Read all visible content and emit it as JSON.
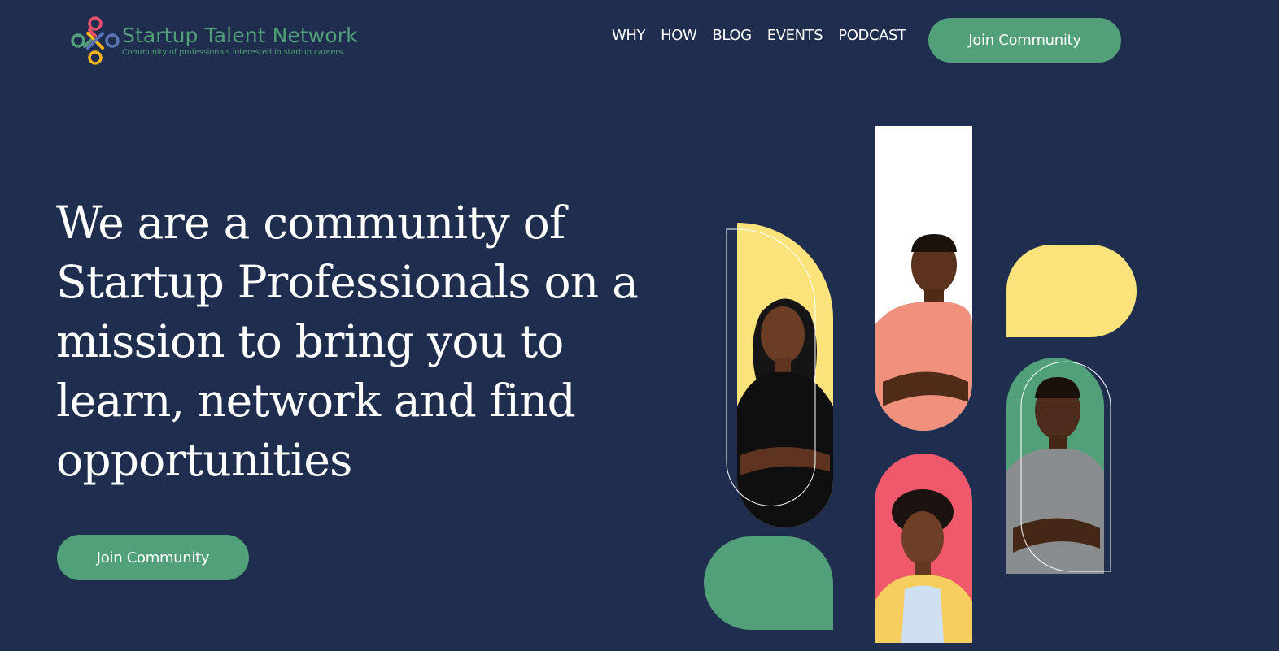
{
  "brand": {
    "name": "Startup Talent Network",
    "tagline": "Community of professionals interested in startup careers",
    "colors": {
      "background": "#1f2d4f",
      "primary_green": "#52a079",
      "yellow": "#fbe27a",
      "coral": "#f0586c",
      "white": "#ffffff"
    }
  },
  "nav": {
    "items": [
      {
        "label": "WHY"
      },
      {
        "label": "HOW"
      },
      {
        "label": "BLOG"
      },
      {
        "label": "EVENTS"
      },
      {
        "label": "PODCAST"
      }
    ],
    "cta_label": "Join Community"
  },
  "hero": {
    "headline": "We are a community of Startup Professionals on a mission to bring you to learn, network and find opportunities",
    "cta_label": "Join Community"
  },
  "collage": {
    "people": [
      {
        "name": "woman-black-top-photo"
      },
      {
        "name": "man-pink-shirt-photo"
      },
      {
        "name": "woman-yellow-blazer-photo"
      },
      {
        "name": "man-grey-shirt-photo"
      }
    ]
  }
}
